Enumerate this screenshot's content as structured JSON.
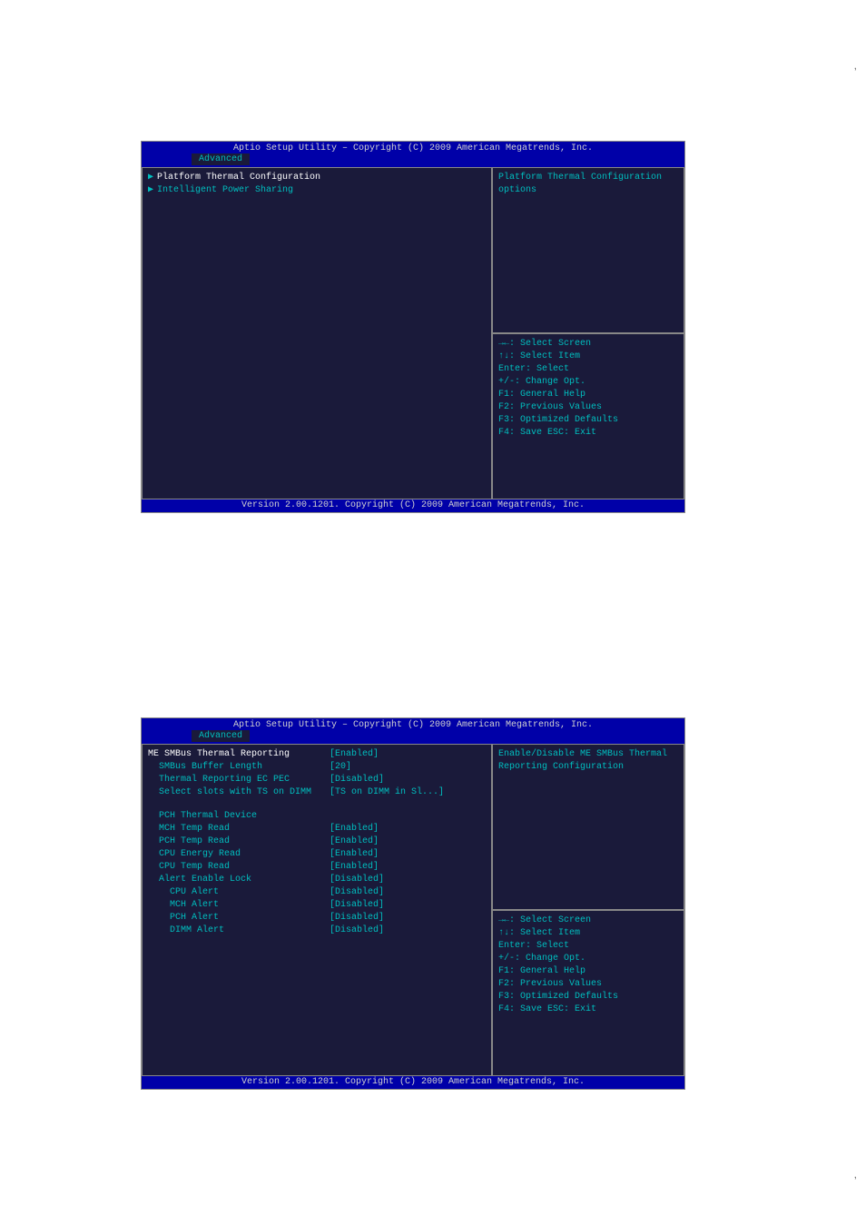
{
  "page_marker": ",",
  "screens": [
    {
      "title": "Aptio Setup Utility – Copyright (C) 2009 American Megatrends, Inc.",
      "tab": "Advanced",
      "menu_items": [
        {
          "label": "Platform Thermal Configuration",
          "value": "",
          "selected": true,
          "submenu": true
        },
        {
          "label": "Intelligent Power Sharing",
          "value": "",
          "selected": false,
          "submenu": true
        }
      ],
      "help_text": "Platform Thermal Configuration options",
      "keys": [
        "→←: Select Screen",
        "↑↓: Select Item",
        "Enter: Select",
        "+/-: Change Opt.",
        "F1: General Help",
        "F2: Previous Values",
        "F3: Optimized Defaults",
        "F4: Save  ESC: Exit"
      ],
      "footer": "Version 2.00.1201. Copyright (C) 2009 American Megatrends, Inc."
    },
    {
      "title": "Aptio Setup Utility – Copyright (C) 2009 American Megatrends, Inc.",
      "tab": "Advanced",
      "menu_items": [
        {
          "label": "ME SMBus Thermal Reporting",
          "value": "[Enabled]",
          "selected": true,
          "indent": 0
        },
        {
          "label": "SMBus Buffer Length",
          "value": "[20]",
          "indent": 1
        },
        {
          "label": "Thermal Reporting EC PEC",
          "value": "[Disabled]",
          "indent": 1
        },
        {
          "label": "Select slots with TS on DIMM",
          "value": "[TS on DIMM in Sl...]",
          "indent": 1
        }
      ],
      "section_header": "PCH Thermal Device",
      "section_items": [
        {
          "label": "MCH Temp Read",
          "value": "[Enabled]",
          "indent": 1
        },
        {
          "label": "PCH Temp Read",
          "value": "[Enabled]",
          "indent": 1
        },
        {
          "label": "CPU Energy Read",
          "value": "[Enabled]",
          "indent": 1
        },
        {
          "label": "CPU Temp Read",
          "value": "[Enabled]",
          "indent": 1
        },
        {
          "label": "Alert Enable Lock",
          "value": "[Disabled]",
          "indent": 1
        },
        {
          "label": "CPU Alert",
          "value": "[Disabled]",
          "indent": 2
        },
        {
          "label": "MCH Alert",
          "value": "[Disabled]",
          "indent": 2
        },
        {
          "label": "PCH Alert",
          "value": "[Disabled]",
          "indent": 2
        },
        {
          "label": "DIMM Alert",
          "value": "[Disabled]",
          "indent": 2
        }
      ],
      "help_text": "Enable/Disable ME SMBus Thermal Reporting Configuration",
      "keys": [
        "→←: Select Screen",
        "↑↓: Select Item",
        "Enter: Select",
        "+/-: Change Opt.",
        "F1: General Help",
        "F2: Previous Values",
        "F3: Optimized Defaults",
        "F4: Save  ESC: Exit"
      ],
      "footer": "Version 2.00.1201. Copyright (C) 2009 American Megatrends, Inc."
    }
  ]
}
